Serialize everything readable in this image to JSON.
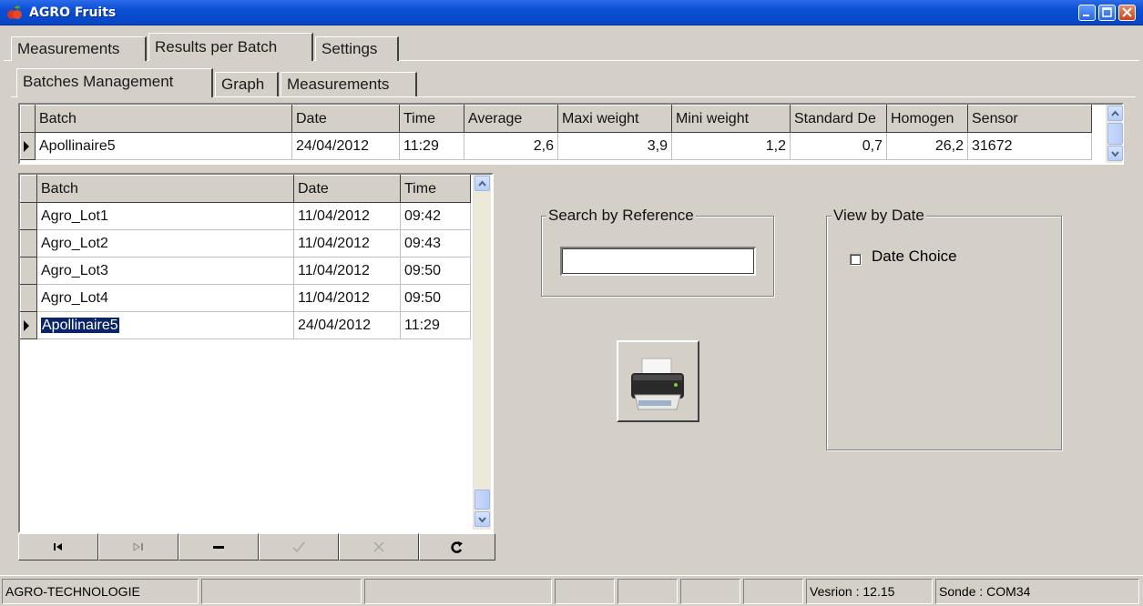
{
  "window": {
    "title": "AGRO Fruits"
  },
  "main_tabs": [
    {
      "label": "Measurements"
    },
    {
      "label": "Results per Batch"
    },
    {
      "label": "Settings"
    }
  ],
  "sub_tabs": [
    {
      "label": "Batches Management"
    },
    {
      "label": "Graph"
    },
    {
      "label": "Measurements"
    }
  ],
  "results_grid": {
    "columns": [
      "Batch",
      "Date",
      "Time",
      "Average",
      "Maxi weight",
      "Mini weight",
      "Standard De",
      "Homogen",
      "Sensor"
    ],
    "rows": [
      [
        "Apollinaire5",
        "24/04/2012",
        "11:29",
        "2,6",
        "3,9",
        "1,2",
        "0,7",
        "26,2",
        "31672"
      ]
    ]
  },
  "batches_grid": {
    "columns": [
      "Batch",
      "Date",
      "Time"
    ],
    "rows": [
      [
        "Agro_Lot1",
        "11/04/2012",
        "09:42"
      ],
      [
        "Agro_Lot2",
        "11/04/2012",
        "09:43"
      ],
      [
        "Agro_Lot3",
        "11/04/2012",
        "09:50"
      ],
      [
        "Agro_Lot4",
        "11/04/2012",
        "09:50"
      ],
      [
        "Apollinaire5",
        "24/04/2012",
        "11:29"
      ]
    ],
    "selected_row": 4
  },
  "search_group": {
    "caption": "Search by Reference",
    "value": ""
  },
  "date_group": {
    "caption": "View by Date",
    "checkbox_label": "Date Choice",
    "checked": false
  },
  "print_button": {
    "icon": "printer-icon"
  },
  "navigator": {
    "buttons": [
      "first-record",
      "last-record",
      "delete-record",
      "post-edit",
      "cancel-edit",
      "refresh"
    ]
  },
  "statusbar": {
    "company": "AGRO-TECHNOLOGIE",
    "version": "Vesrion : 12.15",
    "probe": "Sonde : COM34"
  },
  "colors": {
    "titlebar": "#0a4fd6",
    "face": "#d4d0c8",
    "selection": "#0a246a"
  }
}
